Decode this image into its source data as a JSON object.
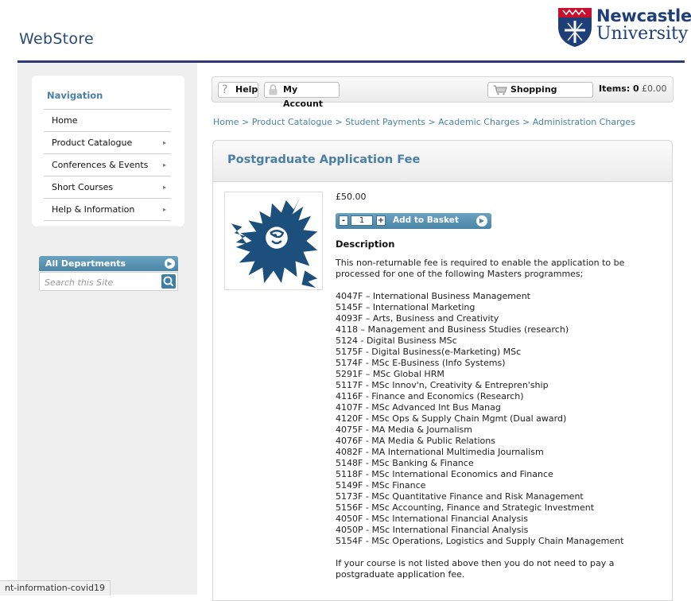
{
  "header": {
    "site_title": "WebStore",
    "logo_line1": "Newcastle",
    "logo_line2": "University"
  },
  "sidebar": {
    "nav_title": "Navigation",
    "items": [
      {
        "label": "Home",
        "has_arrow": false
      },
      {
        "label": "Product Catalogue",
        "has_arrow": true
      },
      {
        "label": "Conferences & Events",
        "has_arrow": true
      },
      {
        "label": "Short Courses",
        "has_arrow": true
      },
      {
        "label": "Help & Information",
        "has_arrow": true
      }
    ],
    "departments_label": "All Departments",
    "search_placeholder": "Search this Site"
  },
  "toolbar": {
    "help_label": "Help",
    "account_label": "My Account",
    "shopping_label": "Shopping",
    "items_label": "Items: 0",
    "items_total": "£0.00"
  },
  "breadcrumb": [
    "Home",
    "Product Catalogue",
    "Student Payments",
    "Academic Charges",
    "Administration Charges"
  ],
  "product": {
    "title": "Postgraduate Application Fee",
    "price": "£50.00",
    "quantity": "1",
    "add_to_basket_label": "Add to Basket",
    "description_heading": "Description",
    "description_intro": "This non-returnable fee is required to enable the application to be processed for one of the following Masters programmes;",
    "courses": [
      "4047F – International Business Management",
      "5145F – International Marketing",
      "4093F – Arts, Business and Creativity",
      "4118 – Management and Business Studies (research)",
      "5124 - Digital Business MSc",
      "5175F - Digital Business(e-Marketing) MSc",
      "5174F - MSc E-Business (Info Systems)",
      "5291F – MSc Global HRM",
      "5117F - MSc Innov'n, Creativity & Entrepren'ship",
      "4116F - Finance and Economics (Research)",
      "4107F - MSc Advanced Int Bus Manag",
      "4120F - MSc Ops & Supply Chain Mgmt (Dual award)",
      "4075F - MA Media & Journalism",
      "4076F - MA Media & Public Relations",
      "4082F - MA International Multimedia Journalism",
      "5148F - MSc Banking & Finance",
      "5118F - MSc International Economics and Finance",
      "5149F - MSc Finance",
      "5173F - MSc Quantitative Finance and Risk Management",
      "5156F - MSc Accounting, Finance and Strategic Investment",
      "4050F - MSc International Financial Analysis",
      "4050P - MSc International Financial Analysis",
      "5154F - MSc Operations, Logistics and Supply Chain Management"
    ],
    "description_outro": "If your course is not listed above then you do not need to pay a postgraduate application fee."
  },
  "status_bar": {
    "url_fragment": "nt-information-covid19"
  },
  "colors": {
    "header_rule": "#2d3a78",
    "accent_blue": "#4a7fa5",
    "button_blue": "#4a85a7",
    "logo_navy": "#1e3e78"
  }
}
